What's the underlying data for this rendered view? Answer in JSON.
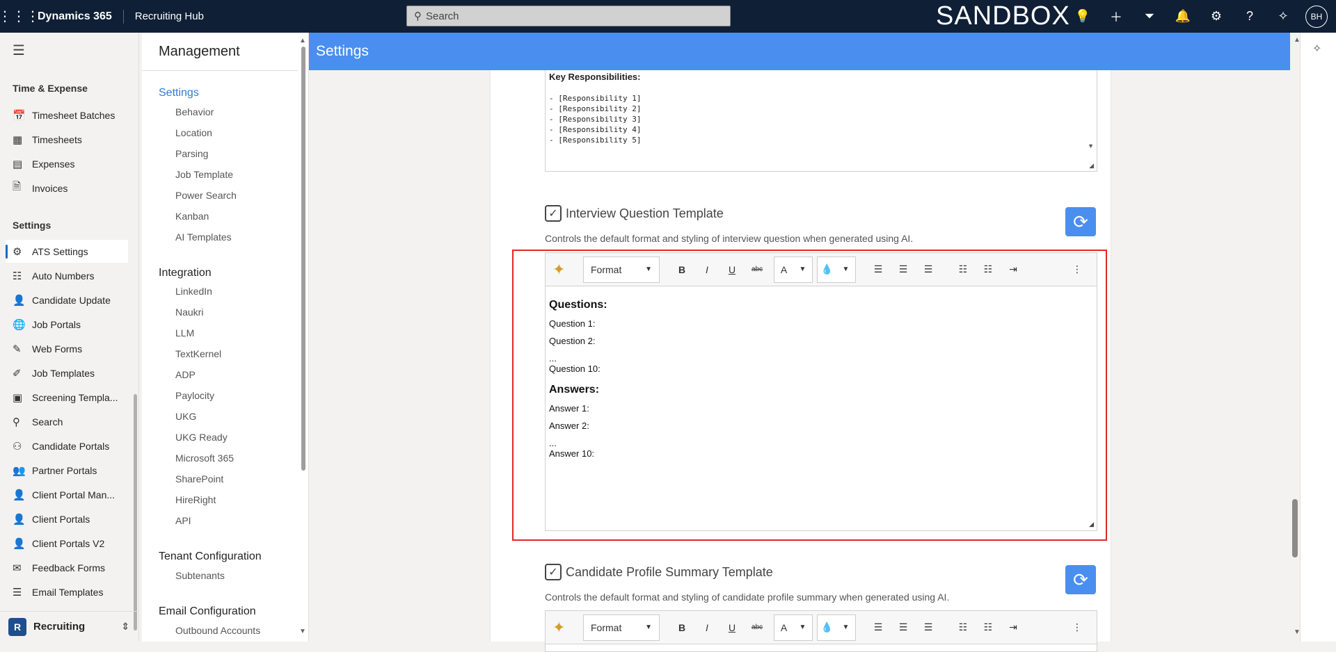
{
  "topbar": {
    "brand": "Dynamics 365",
    "app": "Recruiting Hub",
    "search_placeholder": "Search",
    "env_label": "SANDBOX",
    "avatar": "BH",
    "icons": [
      "lightbulb-icon",
      "plus-icon",
      "filter-icon",
      "bell-icon",
      "gear-icon",
      "help-icon",
      "copilot-icon"
    ]
  },
  "leftnav": {
    "section1": "Time & Expense",
    "section1_items": [
      {
        "label": "Timesheet Batches",
        "icon": "calendar-icon"
      },
      {
        "label": "Timesheets",
        "icon": "calendar-grid-icon"
      },
      {
        "label": "Expenses",
        "icon": "document-icon"
      },
      {
        "label": "Invoices",
        "icon": "invoice-icon"
      }
    ],
    "section2": "Settings",
    "section2_items": [
      {
        "label": "ATS Settings",
        "icon": "gear-icon",
        "active": true
      },
      {
        "label": "Auto Numbers",
        "icon": "numbered-list-icon"
      },
      {
        "label": "Candidate Update",
        "icon": "person-edit-icon"
      },
      {
        "label": "Job Portals",
        "icon": "globe-icon"
      },
      {
        "label": "Web Forms",
        "icon": "form-icon"
      },
      {
        "label": "Job Templates",
        "icon": "template-icon"
      },
      {
        "label": "Screening Templa...",
        "icon": "screening-icon"
      },
      {
        "label": "Search",
        "icon": "search-people-icon"
      },
      {
        "label": "Candidate Portals",
        "icon": "portal-icon"
      },
      {
        "label": "Partner Portals",
        "icon": "people-icon"
      },
      {
        "label": "Client Portal Man...",
        "icon": "person-gear-icon"
      },
      {
        "label": "Client Portals",
        "icon": "person-icon"
      },
      {
        "label": "Client Portals V2",
        "icon": "person-icon"
      },
      {
        "label": "Feedback Forms",
        "icon": "feedback-icon"
      },
      {
        "label": "Email Templates",
        "icon": "layers-icon"
      }
    ],
    "area": {
      "badge": "R",
      "label": "Recruiting"
    }
  },
  "management": {
    "title": "Management",
    "groups": [
      {
        "label": "Settings",
        "items": [
          "Behavior",
          "Location",
          "Parsing",
          "Job Template",
          "Power Search",
          "Kanban",
          "AI Templates"
        ]
      },
      {
        "label": "Integration",
        "items": [
          "LinkedIn",
          "Naukri",
          "LLM",
          "TextKernel",
          "ADP",
          "Paylocity",
          "UKG",
          "UKG Ready",
          "Microsoft 365",
          "SharePoint",
          "HireRight",
          "API"
        ]
      },
      {
        "label": "Tenant Configuration",
        "items": [
          "Subtenants"
        ]
      },
      {
        "label": "Email Configuration",
        "items": [
          "Outbound Accounts"
        ]
      }
    ]
  },
  "header": {
    "title": "Settings"
  },
  "prev_editor": {
    "heading": "Key Responsibilities:",
    "lines": [
      "- [Responsibility 1]",
      "- [Responsibility 2]",
      "- [Responsibility 3]",
      "- [Responsibility 4]",
      "- [Responsibility 5]"
    ]
  },
  "interview": {
    "title": "Interview Question Template",
    "description": "Controls the default format and styling of interview question when generated using AI.",
    "toolbar": {
      "format": "Format",
      "bold": "B",
      "italic": "I",
      "underline": "U",
      "strike": "abc",
      "font_color": "A"
    },
    "content": {
      "q_heading": "Questions:",
      "q1": "Question 1:",
      "q2": "Question 2:",
      "q_ellipsis": "...",
      "q10": "Question 10:",
      "a_heading": "Answers:",
      "a1": "Answer 1:",
      "a2": "Answer 2:",
      "a_ellipsis": "...",
      "a10": "Answer 10:"
    }
  },
  "candidate_summary": {
    "title": "Candidate Profile Summary Template",
    "description": "Controls the default format and styling of candidate profile summary when generated using AI.",
    "toolbar": {
      "format": "Format",
      "bold": "B",
      "italic": "I",
      "underline": "U",
      "strike": "abc",
      "font_color": "A"
    }
  },
  "colors": {
    "topbar": "#0f1f36",
    "header": "#4a8ef0",
    "highlight": "#e02727",
    "ai_icon": "#d79c25"
  }
}
